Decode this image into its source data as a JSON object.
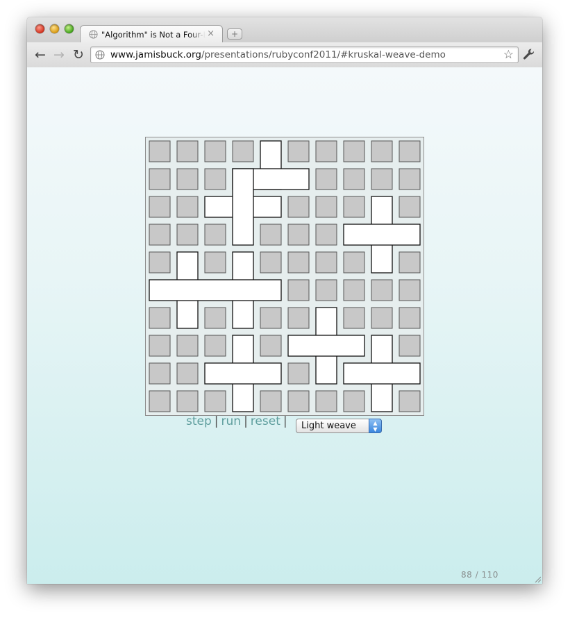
{
  "tab": {
    "title": "\"Algorithm\" is Not a Four-Letter Word",
    "close": "×",
    "new_tab": "+"
  },
  "toolbar": {
    "back": "←",
    "forward": "→",
    "reload": "↻",
    "url_host": "www.jamisbuck.org",
    "url_path": "/presentations/rubyconf2011/#kruskal-weave-demo",
    "star": "☆"
  },
  "icons": {
    "globe": "globe-icon",
    "wrench": "wrench-icon",
    "star": "star-icon"
  },
  "demo": {
    "maze": {
      "rows": 10,
      "cols": 10,
      "cell_fill": "#c8c8c8",
      "passage_fill": "#ffffff",
      "stroke": "#111111"
    },
    "controls": {
      "step": "step",
      "run": "run",
      "reset": "reset",
      "separator": "|",
      "mode_selected": "Light weave"
    }
  },
  "slide": {
    "page": "88 / 110"
  },
  "colors": {
    "link": "#5f9e9e",
    "background_top": "#f4f9fb",
    "background_bottom": "#cbeded",
    "select_accent": "#3a86de"
  }
}
